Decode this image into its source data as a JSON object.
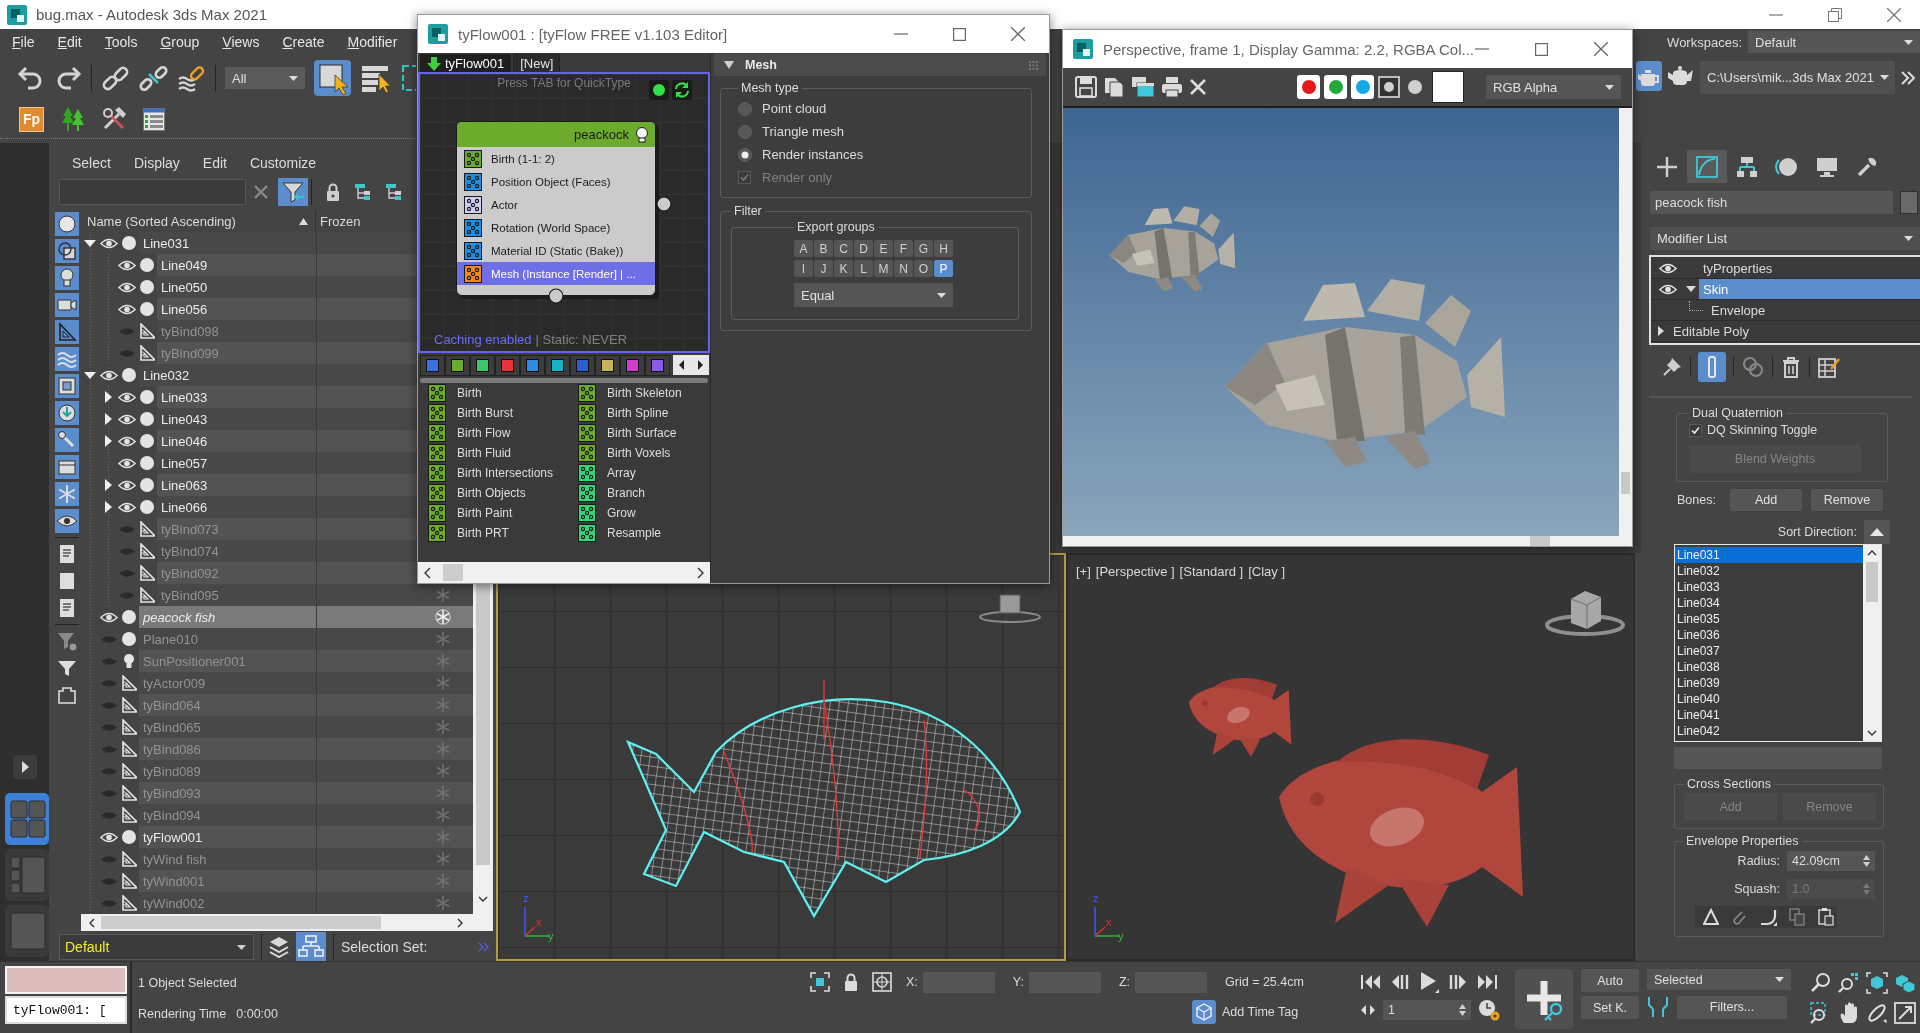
{
  "window": {
    "title": "bug.max - Autodesk 3ds Max 2021"
  },
  "menu_bar": {
    "items": [
      "File",
      "Edit",
      "Tools",
      "Group",
      "Views",
      "Create",
      "Modifier"
    ]
  },
  "workspaces": {
    "label": "Workspaces:",
    "value": "Default"
  },
  "main_toolbar": {
    "selection_filter": "All",
    "select_tools": [
      {
        "selected": true
      },
      {
        "selected": false
      },
      {
        "selected": false
      }
    ],
    "plugin_label": "Fp",
    "render_tools": [
      {
        "selected": true
      },
      {
        "selected": false
      }
    ],
    "project_path": "C:\\Users\\mik...3ds Max 2021"
  },
  "viewport_layouts": [
    {
      "selected": true
    },
    {
      "selected": false
    },
    {
      "selected": false
    }
  ],
  "scene_explorer": {
    "menu": [
      "Select",
      "Display",
      "Edit",
      "Customize"
    ],
    "filter_button": {
      "selected": true
    },
    "type_filters": [
      {
        "on": true
      },
      {
        "on": true
      },
      {
        "on": true
      },
      {
        "on": true
      },
      {
        "on": true
      },
      {
        "on": true
      },
      {
        "on": true
      },
      {
        "on": true
      },
      {
        "on": true
      },
      {
        "on": true
      },
      {
        "on": true
      },
      {
        "on": true
      },
      {
        "on": false
      },
      {
        "on": false
      },
      {
        "on": false
      },
      {
        "on": false
      },
      {
        "on": false
      },
      {
        "on": false
      }
    ],
    "columns": [
      "Name (Sorted Ascending)",
      "Frozen"
    ],
    "rows": [
      {
        "name": "Line031",
        "kind": "geometry",
        "visible": true,
        "selected": false,
        "italic": false,
        "expanded": true,
        "children": [
          {
            "name": "Line049",
            "kind": "geometry",
            "visible": true,
            "selected": false,
            "italic": false
          },
          {
            "name": "Line050",
            "kind": "geometry",
            "visible": true,
            "selected": false,
            "italic": false
          },
          {
            "name": "Line056",
            "kind": "geometry",
            "visible": true,
            "selected": false,
            "italic": false
          },
          {
            "name": "tyBind098",
            "kind": "helper",
            "visible": false,
            "selected": false,
            "italic": false
          },
          {
            "name": "tyBind099",
            "kind": "helper",
            "visible": false,
            "selected": false,
            "italic": false
          }
        ]
      },
      {
        "name": "Line032",
        "kind": "geometry",
        "visible": true,
        "selected": false,
        "italic": false,
        "expanded": true,
        "children": [
          {
            "name": "Line033",
            "kind": "geometry",
            "visible": true,
            "selected": false,
            "italic": false,
            "expanded": false
          },
          {
            "name": "Line043",
            "kind": "geometry",
            "visible": true,
            "selected": false,
            "italic": false,
            "expanded": false
          },
          {
            "name": "Line046",
            "kind": "geometry",
            "visible": true,
            "selected": false,
            "italic": false,
            "expanded": false
          },
          {
            "name": "Line057",
            "kind": "geometry",
            "visible": true,
            "selected": false,
            "italic": false
          },
          {
            "name": "Line063",
            "kind": "geometry",
            "visible": true,
            "selected": false,
            "italic": false,
            "expanded": false
          },
          {
            "name": "Line066",
            "kind": "geometry",
            "visible": true,
            "selected": false,
            "italic": false,
            "expanded": false
          },
          {
            "name": "tyBind073",
            "kind": "helper",
            "visible": false,
            "selected": false,
            "italic": false
          },
          {
            "name": "tyBind074",
            "kind": "helper",
            "visible": false,
            "selected": false,
            "italic": false
          },
          {
            "name": "tyBind092",
            "kind": "helper",
            "visible": false,
            "selected": false,
            "italic": false
          },
          {
            "name": "tyBind095",
            "kind": "helper",
            "visible": false,
            "selected": false,
            "italic": false,
            "frozen": false
          }
        ]
      },
      {
        "name": "peacock fish",
        "kind": "geometry",
        "visible": true,
        "selected": true,
        "italic": true,
        "frozen": false
      },
      {
        "name": "Plane010",
        "kind": "geometry",
        "visible": false,
        "selected": false,
        "italic": false,
        "frozen": false
      },
      {
        "name": "SunPositioner001",
        "kind": "light",
        "visible": false,
        "selected": false,
        "italic": false,
        "frozen": false
      },
      {
        "name": "tyActor009",
        "kind": "helper",
        "visible": false,
        "selected": false,
        "italic": false,
        "frozen": false
      },
      {
        "name": "tyBind064",
        "kind": "helper",
        "visible": false,
        "selected": false,
        "italic": false,
        "frozen": false
      },
      {
        "name": "tyBind065",
        "kind": "helper",
        "visible": false,
        "selected": false,
        "italic": false,
        "frozen": false
      },
      {
        "name": "tyBind086",
        "kind": "helper",
        "visible": false,
        "selected": false,
        "italic": false,
        "frozen": false
      },
      {
        "name": "tyBind089",
        "kind": "helper",
        "visible": false,
        "selected": false,
        "italic": false,
        "frozen": false
      },
      {
        "name": "tyBind093",
        "kind": "helper",
        "visible": false,
        "selected": false,
        "italic": false,
        "frozen": false
      },
      {
        "name": "tyBind094",
        "kind": "helper",
        "visible": false,
        "selected": false,
        "italic": false,
        "frozen": false
      },
      {
        "name": "tyFlow001",
        "kind": "geometry",
        "visible": true,
        "selected": false,
        "italic": false,
        "frozen": false
      },
      {
        "name": "tyWind fish",
        "kind": "helper",
        "visible": false,
        "selected": false,
        "italic": false,
        "frozen": false
      },
      {
        "name": "tyWind001",
        "kind": "helper",
        "visible": false,
        "selected": false,
        "italic": false,
        "frozen": false
      },
      {
        "name": "tyWind002",
        "kind": "helper",
        "visible": false,
        "selected": false,
        "italic": false,
        "frozen": false
      }
    ],
    "layer": "Default",
    "selection_set_button": {
      "selected": true
    },
    "selection_set_label": "Selection Set:"
  },
  "tyflow_editor": {
    "title": "tyFlow001 : [tyFlow FREE v1.103 Editor]",
    "tabs": [
      {
        "label": "tyFlow001",
        "selected": true
      },
      {
        "label": "[New]",
        "selected": false
      }
    ],
    "hint": "Press TAB for QuickType",
    "event": {
      "title": "peackock",
      "operators": [
        {
          "label": "Birth (1-1: 2)",
          "color": "#6cab2c",
          "selected": false
        },
        {
          "label": "Position Object (Faces)",
          "color": "#1f8fe5",
          "selected": false
        },
        {
          "label": "Actor",
          "color": "#cfcff5",
          "selected": false
        },
        {
          "label": "Rotation (World Space)",
          "color": "#1f8fe5",
          "selected": false
        },
        {
          "label": "Material ID (Static (Bake))",
          "color": "#1f8fe5",
          "selected": false
        },
        {
          "label": "Mesh (Instance [Render] | ...",
          "color": "#f48a1f",
          "selected": true
        }
      ]
    },
    "caching": "Caching enabled",
    "static_mode": "| Static: NEVER",
    "categories": [
      {
        "color": "#3d6fe0"
      },
      {
        "color": "#6cab2c"
      },
      {
        "color": "#3fc46e"
      },
      {
        "color": "#e8323c"
      },
      {
        "color": "#2d8ae0"
      },
      {
        "color": "#19b2c2"
      },
      {
        "color": "#2a5fd0"
      },
      {
        "color": "#c8b35a"
      },
      {
        "color": "#d03ccb"
      },
      {
        "color": "#8a5ae6"
      }
    ],
    "operators": [
      {
        "label": "Birth",
        "color": "#6cab2c"
      },
      {
        "label": "Birth Burst",
        "color": "#6cab2c"
      },
      {
        "label": "Birth Flow",
        "color": "#6cab2c"
      },
      {
        "label": "Birth Fluid",
        "color": "#6cab2c"
      },
      {
        "label": "Birth Intersections",
        "color": "#6cab2c"
      },
      {
        "label": "Birth Objects",
        "color": "#6cab2c"
      },
      {
        "label": "Birth Paint",
        "color": "#6cab2c"
      },
      {
        "label": "Birth PRT",
        "color": "#6cab2c"
      },
      {
        "label": "Birth Skeleton",
        "color": "#6cab2c"
      },
      {
        "label": "Birth Spline",
        "color": "#6cab2c"
      },
      {
        "label": "Birth Surface",
        "color": "#6cab2c"
      },
      {
        "label": "Birth Voxels",
        "color": "#6cab2c"
      },
      {
        "label": "Array",
        "color": "#35d67a"
      },
      {
        "label": "Branch",
        "color": "#35d67a"
      },
      {
        "label": "Grow",
        "color": "#35d67a"
      },
      {
        "label": "Resample",
        "color": "#35d67a"
      }
    ],
    "mesh_panel": {
      "title": "Mesh",
      "expanded": true,
      "mesh_type": {
        "label": "Mesh type",
        "options": [
          {
            "label": "Point cloud",
            "selected": false
          },
          {
            "label": "Triangle mesh",
            "selected": false
          },
          {
            "label": "Render instances",
            "selected": true
          }
        ],
        "render_only": {
          "label": "Render only",
          "checked": true,
          "disabled": true
        }
      },
      "filter": {
        "label": "Filter",
        "export_groups": {
          "label": "Export groups",
          "letters": [
            {
              "label": "A",
              "selected": false
            },
            {
              "label": "B",
              "selected": false
            },
            {
              "label": "C",
              "selected": false
            },
            {
              "label": "D",
              "selected": false
            },
            {
              "label": "E",
              "selected": false
            },
            {
              "label": "F",
              "selected": false
            },
            {
              "label": "G",
              "selected": false
            },
            {
              "label": "H",
              "selected": false
            },
            {
              "label": "I",
              "selected": false
            },
            {
              "label": "J",
              "selected": false
            },
            {
              "label": "K",
              "selected": false
            },
            {
              "label": "L",
              "selected": false
            },
            {
              "label": "M",
              "selected": false
            },
            {
              "label": "N",
              "selected": false
            },
            {
              "label": "O",
              "selected": false
            },
            {
              "label": "P",
              "selected": true
            }
          ],
          "mode": "Equal"
        }
      }
    }
  },
  "render_window": {
    "title": "Perspective, frame 1, Display Gamma: 2.2, RGBA Col...",
    "channels": [
      {
        "color": "#e3191b",
        "on": true
      },
      {
        "color": "#22a83c",
        "on": true
      },
      {
        "color": "#13a8e8",
        "on": true
      }
    ],
    "display_channel": "RGB Alpha"
  },
  "viewports": [
    {
      "active": true,
      "axes": [
        "z",
        "x",
        "y"
      ]
    },
    {
      "active": false,
      "labels": [
        "[+]",
        "[Perspective ]",
        "[Standard ]",
        "[Clay ]"
      ],
      "axes": [
        "z",
        "x",
        "y"
      ]
    }
  ],
  "command_panel": {
    "tabs": [
      {
        "selected": false
      },
      {
        "selected": true
      },
      {
        "selected": false
      },
      {
        "selected": false
      },
      {
        "selected": false
      },
      {
        "selected": false
      }
    ],
    "object_name": "peacock fish",
    "modifier_list": "Modifier List",
    "stack": [
      {
        "label": "tyProperties",
        "visible": true,
        "selected": false
      },
      {
        "label": "Skin",
        "visible": true,
        "selected": true,
        "expanded": true,
        "children": [
          {
            "label": "Envelope",
            "selected": false
          }
        ]
      },
      {
        "label": "Editable Poly",
        "selected": false,
        "expanded": false
      }
    ],
    "stack_tools": [
      {
        "selected": false
      },
      {
        "selected": true
      },
      {
        "selected": false
      },
      {
        "selected": false
      },
      {
        "selected": false
      }
    ],
    "dual_quaternion": {
      "label": "Dual Quaternion",
      "toggle": {
        "label": "DQ Skinning Toggle",
        "checked": true
      },
      "blend_weights": {
        "label": "Blend Weights",
        "disabled": true
      }
    },
    "bones": {
      "label": "Bones:",
      "buttons": [
        {
          "label": "Add",
          "disabled": false
        },
        {
          "label": "Remove",
          "disabled": false
        }
      ],
      "sort_label": "Sort Direction:",
      "list": [
        {
          "label": "Line031",
          "selected": true
        },
        {
          "label": "Line032",
          "selected": false
        },
        {
          "label": "Line033",
          "selected": false
        },
        {
          "label": "Line034",
          "selected": false
        },
        {
          "label": "Line035",
          "selected": false
        },
        {
          "label": "Line036",
          "selected": false
        },
        {
          "label": "Line037",
          "selected": false
        },
        {
          "label": "Line038",
          "selected": false
        },
        {
          "label": "Line039",
          "selected": false
        },
        {
          "label": "Line040",
          "selected": false
        },
        {
          "label": "Line041",
          "selected": false
        },
        {
          "label": "Line042",
          "selected": false
        }
      ]
    },
    "cross_sections": {
      "label": "Cross Sections",
      "buttons": [
        {
          "label": "Add",
          "disabled": true
        },
        {
          "label": "Remove",
          "disabled": true
        }
      ]
    },
    "envelope_properties": {
      "label": "Envelope Properties",
      "fields": [
        {
          "label": "Radius:",
          "value": "42.09cm",
          "disabled": false
        },
        {
          "label": "Squash:",
          "value": "1.0",
          "disabled": true
        }
      ]
    }
  },
  "status_bar": {
    "listener_input": "tyFlow001: [",
    "selection": "1 Object Selected",
    "render_time_label": "Rendering Time",
    "render_time": "0:00:00",
    "coords": [
      "X:",
      "Y:",
      "Z:"
    ],
    "grid": "Grid = 25.4cm",
    "time_tag": "Add Time Tag",
    "frame": "1",
    "auto_key": {
      "label": "Auto",
      "on": false
    },
    "set_key": "Set K.",
    "key_filter": "Selected",
    "filters": "Filters..."
  }
}
